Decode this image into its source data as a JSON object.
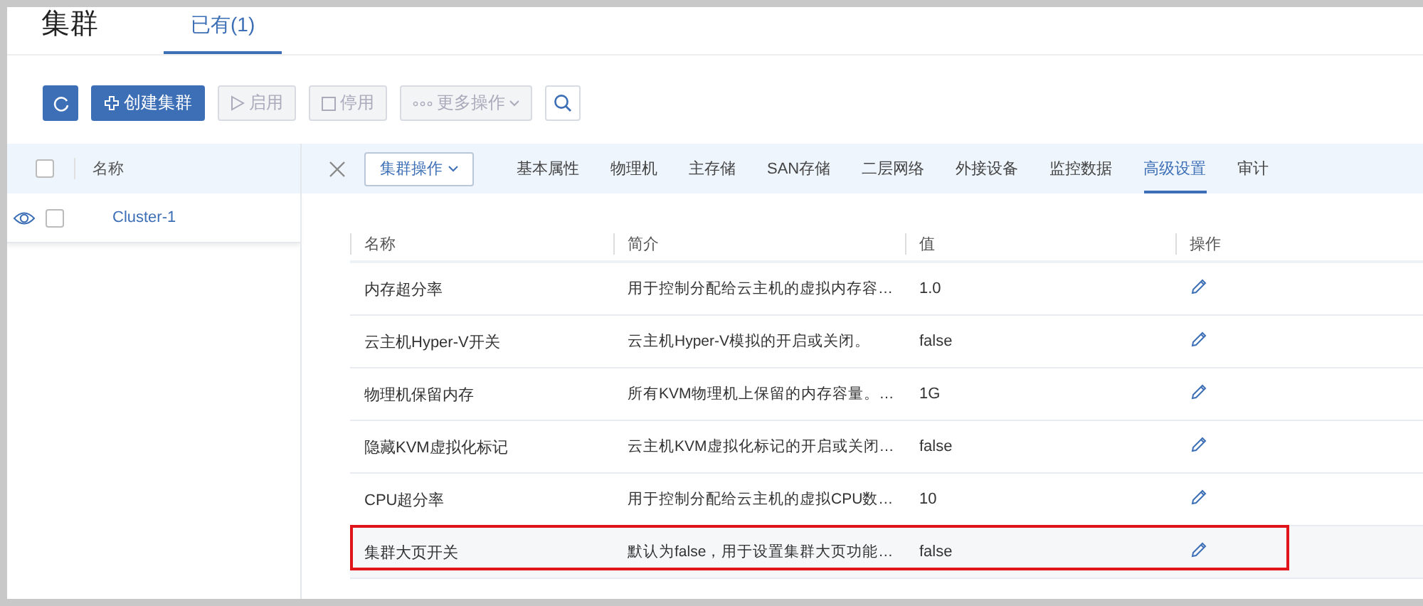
{
  "header": {
    "title": "集群",
    "tabs": [
      {
        "label": "已有(1)",
        "selected": true
      }
    ]
  },
  "toolbar": {
    "buttons": [
      {
        "kind": "refresh",
        "disabled": false
      },
      {
        "kind": "create",
        "label": "创建集群",
        "disabled": false
      },
      {
        "kind": "enable",
        "label": "启用",
        "disabled": true
      },
      {
        "kind": "disable",
        "label": "停用",
        "disabled": true
      },
      {
        "kind": "more",
        "label": "更多操作",
        "disabled": true
      },
      {
        "kind": "search",
        "disabled": false
      }
    ]
  },
  "list": {
    "all_checked": false,
    "column": "名称",
    "rows": [
      {
        "name": "Cluster-1",
        "checked": false
      }
    ]
  },
  "detail": {
    "action_button": "集群操作",
    "tabs": [
      {
        "label": "基本属性",
        "selected": false
      },
      {
        "label": "物理机",
        "selected": false
      },
      {
        "label": "主存储",
        "selected": false
      },
      {
        "label": "SAN存储",
        "selected": false
      },
      {
        "label": "二层网络",
        "selected": false
      },
      {
        "label": "外接设备",
        "selected": false
      },
      {
        "label": "监控数据",
        "selected": false
      },
      {
        "label": "高级设置",
        "selected": true
      },
      {
        "label": "审计",
        "selected": false
      }
    ],
    "table": {
      "columns": [
        "名称",
        "简介",
        "值",
        "操作"
      ],
      "rows": [
        {
          "name": "内存超分率",
          "description": "用于控制分配给云主机的虚拟内存容…",
          "value": "1.0",
          "highlighted": false
        },
        {
          "name": "云主机Hyper-V开关",
          "description": "云主机Hyper-V模拟的开启或关闭。",
          "value": "false",
          "highlighted": false
        },
        {
          "name": "物理机保留内存",
          "description": "所有KVM物理机上保留的内存容量。…",
          "value": "1G",
          "highlighted": false
        },
        {
          "name": "隐藏KVM虚拟化标记",
          "description": "云主机KVM虚拟化标记的开启或关闭…",
          "value": "false",
          "highlighted": false
        },
        {
          "name": "CPU超分率",
          "description": "用于控制分配给云主机的虚拟CPU数…",
          "value": "10",
          "highlighted": false
        },
        {
          "name": "集群大页开关",
          "description": "默认为false，用于设置集群大页功能…",
          "value": "false",
          "highlighted": true
        }
      ]
    }
  }
}
